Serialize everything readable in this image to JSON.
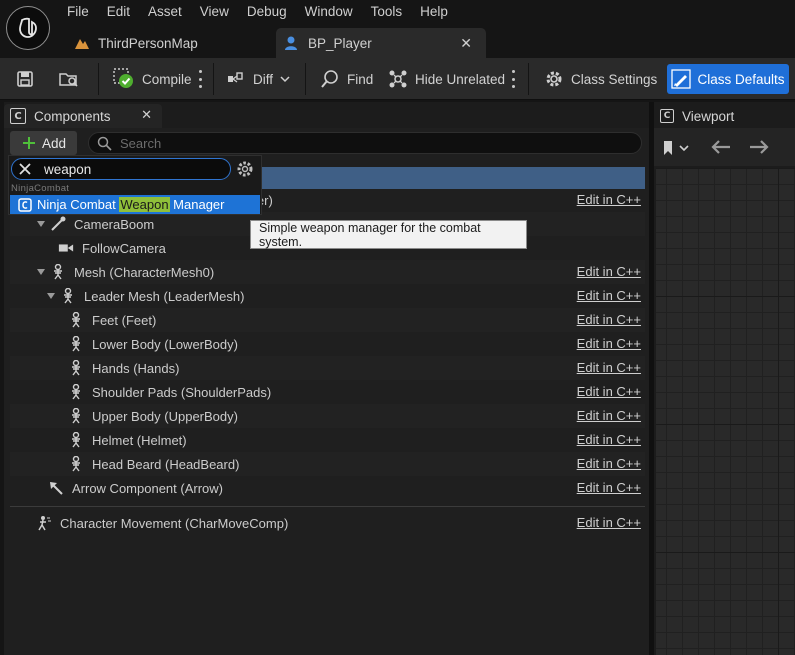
{
  "menu": [
    "File",
    "Edit",
    "Asset",
    "View",
    "Debug",
    "Window",
    "Tools",
    "Help"
  ],
  "tabs": [
    {
      "label": "ThirdPersonMap",
      "icon": "level-icon"
    },
    {
      "label": "BP_Player",
      "icon": "blueprint-icon",
      "active": true
    }
  ],
  "toolbar": {
    "compile": "Compile",
    "diff": "Diff",
    "find": "Find",
    "hide_unrelated": "Hide Unrelated",
    "class_settings": "Class Settings",
    "class_defaults": "Class Defaults"
  },
  "components_panel": {
    "title": "Components",
    "add_label": "Add",
    "search_placeholder": "Search"
  },
  "popup": {
    "search_value": "weapon",
    "category": "NinjaCombat",
    "item_prefix": "Ninja Combat ",
    "item_highlight": "Weapon",
    "item_suffix": " Manager",
    "tooltip": "Simple weapon manager for the combat system."
  },
  "tree": {
    "hidden_row_suffix": "ler)",
    "edit_label": "Edit in C++",
    "rows": [
      {
        "label": "CameraBoom"
      },
      {
        "label": "FollowCamera"
      },
      {
        "label": "Mesh (CharacterMesh0)"
      },
      {
        "label": "Leader Mesh (LeaderMesh)"
      },
      {
        "label": "Feet (Feet)"
      },
      {
        "label": "Lower Body (LowerBody)"
      },
      {
        "label": "Hands (Hands)"
      },
      {
        "label": "Shoulder Pads (ShoulderPads)"
      },
      {
        "label": "Upper Body (UpperBody)"
      },
      {
        "label": "Helmet (Helmet)"
      },
      {
        "label": "Head Beard (HeadBeard)"
      },
      {
        "label": "Arrow Component (Arrow)"
      },
      {
        "label": "Character Movement (CharMoveComp)"
      }
    ]
  },
  "viewport": {
    "title": "Viewport"
  },
  "colors": {
    "accent": "#1e73d6",
    "highlight": "#8fbf3a",
    "selection": "#3f5f86"
  }
}
